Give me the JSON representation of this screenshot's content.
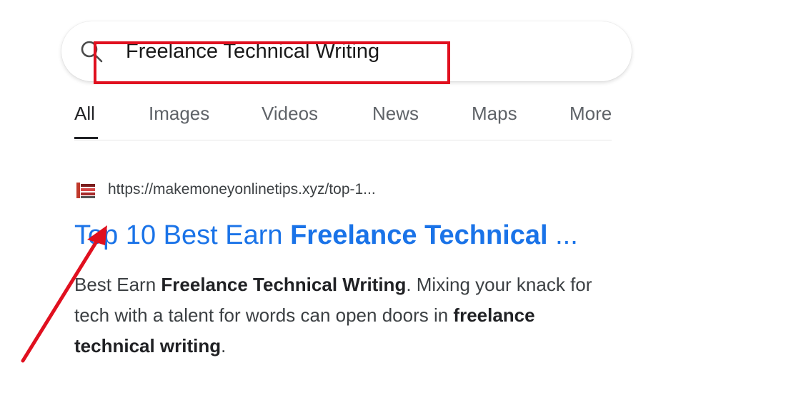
{
  "search": {
    "query": "Freelance Technical Writing"
  },
  "tabs": [
    {
      "label": "All",
      "active": true
    },
    {
      "label": "Images"
    },
    {
      "label": "Videos"
    },
    {
      "label": "News"
    },
    {
      "label": "Maps"
    },
    {
      "label": "More"
    }
  ],
  "result": {
    "url": "https://makemoneyonlinetips.xyz/top-1...",
    "title_prefix": "Top 10 Best Earn ",
    "title_bold": "Freelance Technical",
    "title_suffix": " ...",
    "snippet": {
      "p1": "Best Earn ",
      "b1": "Freelance Technical Writing",
      "p2": ". Mixing your knack for tech with a talent for words can open doors in ",
      "b2": "freelance technical writing",
      "p3": "."
    }
  },
  "annotations": {
    "highlight_color": "#e0101f",
    "arrow_color": "#e0101f"
  },
  "colors": {
    "link": "#1a73e8",
    "text": "#3c4043"
  }
}
